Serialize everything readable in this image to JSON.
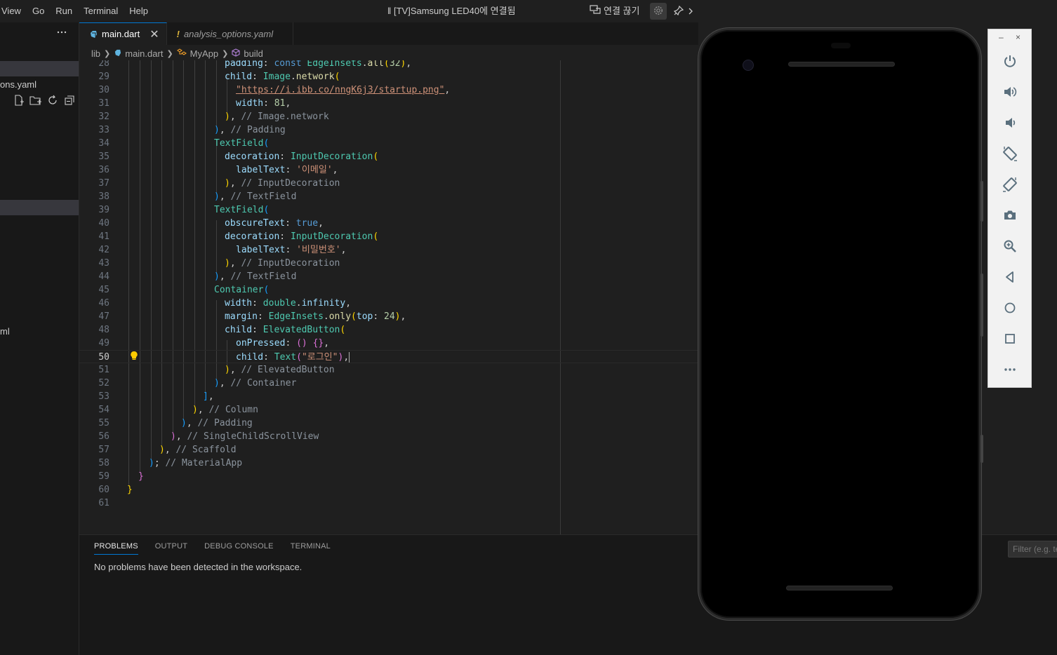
{
  "menu": [
    "View",
    "Go",
    "Run",
    "Terminal",
    "Help"
  ],
  "window_title": "‖ [TV]Samsung LED40에 연결됨",
  "remote": {
    "label": "연결 끊기"
  },
  "sidebar": {
    "files": [
      {
        "label": "ons.yaml"
      },
      {
        "label": "ml"
      }
    ]
  },
  "tabs": [
    {
      "label": "main.dart",
      "active": true
    },
    {
      "label": "analysis_options.yaml",
      "active": false
    }
  ],
  "breadcrumb": [
    "lib",
    "main.dart",
    "MyApp",
    "build"
  ],
  "editor": {
    "current_line": 50,
    "line_numbers": [
      "28",
      "29",
      "30",
      "31",
      "32",
      "33",
      "34",
      "35",
      "36",
      "37",
      "38",
      "39",
      "40",
      "41",
      "42",
      "43",
      "44",
      "45",
      "46",
      "47",
      "48",
      "49",
      "50",
      "51",
      "52",
      "53",
      "54",
      "55",
      "56",
      "57",
      "58",
      "59",
      "60",
      "61"
    ],
    "strings": {
      "url": "\"https://i.ibb.co/nngK6j3/startup.png\"",
      "email_label": "'이메일'",
      "password_label": "'비밀번호'",
      "login_label": "\"로그인\""
    },
    "numbers": {
      "padding_all": "32",
      "width": "81",
      "margin_top": "24"
    }
  },
  "panel": {
    "tabs": [
      "PROBLEMS",
      "OUTPUT",
      "DEBUG CONSOLE",
      "TERMINAL"
    ],
    "active_tab": "PROBLEMS",
    "message": "No problems have been detected in the workspace.",
    "filter_placeholder": "Filter (e.g. text, **/*.ts, !**/node_modules/**)"
  },
  "emulator": {
    "window_controls": [
      "–",
      "×"
    ],
    "tools": [
      "power-icon",
      "volume-up-icon",
      "volume-down-icon",
      "rotate-left-icon",
      "rotate-right-icon",
      "camera-icon",
      "zoom-icon",
      "back-icon",
      "home-icon",
      "overview-icon",
      "more-icon"
    ]
  },
  "colors": {
    "accent": "#0078d4",
    "editor_bg": "#1f1f1f",
    "sidebar_bg": "#181818"
  }
}
